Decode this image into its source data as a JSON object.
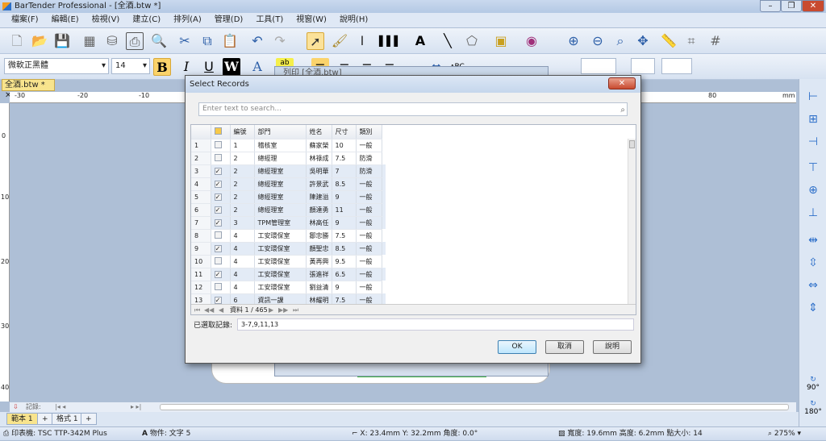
{
  "window": {
    "title": "BarTender Professional - [全酒.btw *]",
    "min": "–",
    "max": "❐",
    "close": "✕"
  },
  "menu": [
    "檔案(F)",
    "編輯(E)",
    "檢視(V)",
    "建立(C)",
    "排列(A)",
    "管理(D)",
    "工具(T)",
    "視窗(W)",
    "說明(H)"
  ],
  "format": {
    "font": "微軟正黑體",
    "size": "14",
    "bold": "B",
    "italic": "I",
    "underline": "U",
    "reverse": "W",
    "color": "A",
    "highlight": "ab",
    "shape": "ᴀBC"
  },
  "doc_tab": {
    "label": "全酒.btw *",
    "close": "✕"
  },
  "ruler": {
    "h": [
      "-30",
      "-20",
      "-10",
      "80",
      "mm"
    ],
    "v": [
      "0",
      "10",
      "20",
      "30",
      "40"
    ]
  },
  "background_dialog_title": "列印 [全酒.btw]",
  "dialog": {
    "title": "Select Records",
    "close": "✕",
    "search_placeholder": "Enter text to search...",
    "columns": [
      "編號",
      "部門",
      "姓名",
      "尺寸",
      "類別"
    ],
    "rows": [
      {
        "n": "1",
        "checked": false,
        "id": "1",
        "dept": "稽核室",
        "name": "蘇家榮",
        "size": "10",
        "type": "一般"
      },
      {
        "n": "2",
        "checked": false,
        "id": "2",
        "dept": "總經理",
        "name": "林祿成",
        "size": "7.5",
        "type": "防滑"
      },
      {
        "n": "3",
        "checked": true,
        "id": "2",
        "dept": "總經理室",
        "name": "吳明華",
        "size": "7",
        "type": "防滑"
      },
      {
        "n": "4",
        "checked": true,
        "id": "2",
        "dept": "總經理室",
        "name": "許景武",
        "size": "8.5",
        "type": "一般"
      },
      {
        "n": "5",
        "checked": true,
        "id": "2",
        "dept": "總經理室",
        "name": "陳建溢",
        "size": "9",
        "type": "一般"
      },
      {
        "n": "6",
        "checked": true,
        "id": "2",
        "dept": "總經理室",
        "name": "顏達勇",
        "size": "11",
        "type": "一般"
      },
      {
        "n": "7",
        "checked": true,
        "id": "3",
        "dept": "TPM管理室",
        "name": "林高任",
        "size": "9",
        "type": "一般"
      },
      {
        "n": "8",
        "checked": false,
        "id": "4",
        "dept": "工安環保室",
        "name": "鄒忠勝",
        "size": "7.5",
        "type": "一般"
      },
      {
        "n": "9",
        "checked": true,
        "id": "4",
        "dept": "工安環保室",
        "name": "顏聖忠",
        "size": "8.5",
        "type": "一般"
      },
      {
        "n": "10",
        "checked": false,
        "id": "4",
        "dept": "工安環保室",
        "name": "黃再興",
        "size": "9.5",
        "type": "一般"
      },
      {
        "n": "11",
        "checked": true,
        "id": "4",
        "dept": "工安環保室",
        "name": "張進祥",
        "size": "6.5",
        "type": "一般"
      },
      {
        "n": "12",
        "checked": false,
        "id": "4",
        "dept": "工安環保室",
        "name": "劉益清",
        "size": "9",
        "type": "一般"
      },
      {
        "n": "13",
        "checked": true,
        "id": "6",
        "dept": "資訊一課",
        "name": "林耀明",
        "size": "7.5",
        "type": "一般"
      }
    ],
    "nav": {
      "first": "⏮",
      "prev_page": "◀◀",
      "prev": "◀",
      "record": "資料 1 / 465",
      "next": "▶",
      "next_page": "▶▶",
      "last": "⏭"
    },
    "selected_label": "已選取記錄:",
    "selected_value": "3-7,9,11,13",
    "ok": "OK",
    "cancel": "取消",
    "help": "說明"
  },
  "bottom": {
    "records_label": "記錄:",
    "tabs": [
      "範本 1",
      "格式 1"
    ]
  },
  "status": {
    "printer": "印表機: TSC TTP-342M Plus",
    "object": "物件: 文字 5",
    "position": "X: 23.4mm  Y: 32.2mm  角度: 0.0°",
    "size": "寬度: 19.6mm  高度: 6.2mm  點大小: 14",
    "zoom": "275%"
  },
  "rotate": {
    "r90": "90°",
    "r180": "180°"
  }
}
